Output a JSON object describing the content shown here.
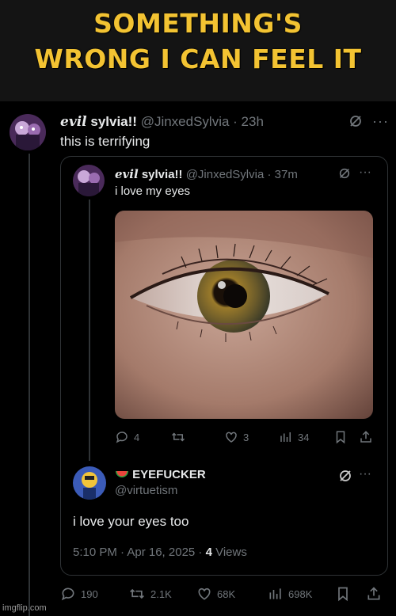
{
  "meme": {
    "line1": "SOMETHING'S",
    "line2": "WRONG I CAN FEEL IT"
  },
  "main_tweet": {
    "name_prefix": "evil",
    "name_rest": "sylvia!!",
    "handle": "@JinxedSylvia",
    "time": "23h",
    "text": "this is terrifying",
    "stats": {
      "replies": "190",
      "retweets": "2.1K",
      "likes": "68K",
      "views": "698K"
    }
  },
  "quoted_tweet": {
    "name_prefix": "evil",
    "name_rest": "sylvia!!",
    "handle": "@JinxedSylvia",
    "time": "37m",
    "text": "i love my eyes",
    "stats": {
      "replies": "4",
      "retweets": "",
      "likes": "3",
      "views": "34"
    }
  },
  "reply_tweet": {
    "name": "EYEFUCKER",
    "handle": "@virtuetism",
    "text": "i love your eyes too",
    "timestamp": "5:10 PM · Apr 16, 2025 · ",
    "views_count": "4",
    "views_label": " Views"
  },
  "watermark": "imgflip.com",
  "icons": [
    "slash-circle-icon",
    "more-icon",
    "reply-icon",
    "retweet-icon",
    "like-icon",
    "views-icon",
    "bookmark-icon",
    "share-icon",
    "watermelon-icon"
  ],
  "colors": {
    "meme_text": "#f3c332",
    "background": "#000000",
    "secondary_text": "#71767b",
    "border": "#2f3336"
  }
}
